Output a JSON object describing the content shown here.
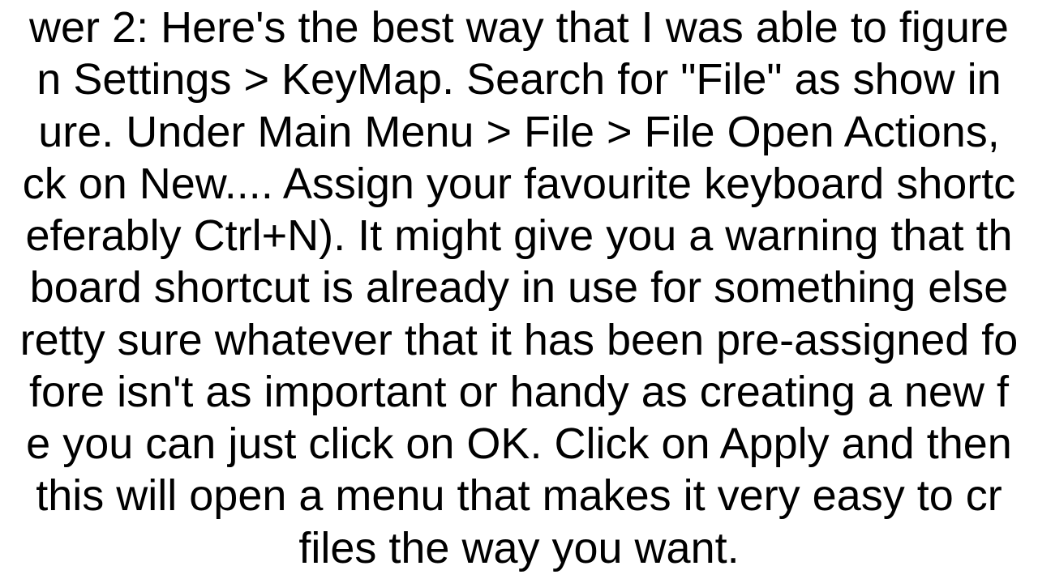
{
  "body": {
    "text": "wer 2: Here's the best way that I was able to figure\nn Settings > KeyMap. Search for \"File\" as show in\nure.  Under Main Menu > File > File Open Actions,\nck on New.... Assign your favourite keyboard shortc\neferably Ctrl+N). It might give you a warning that th\nboard shortcut is already in use for something else\nretty sure whatever that it has been pre-assigned fo\nfore isn't as important or handy as creating a new f\ne you can just click on OK. Click on Apply and then\n this will open a menu that makes it very easy to cr\nfiles the way you want."
  }
}
